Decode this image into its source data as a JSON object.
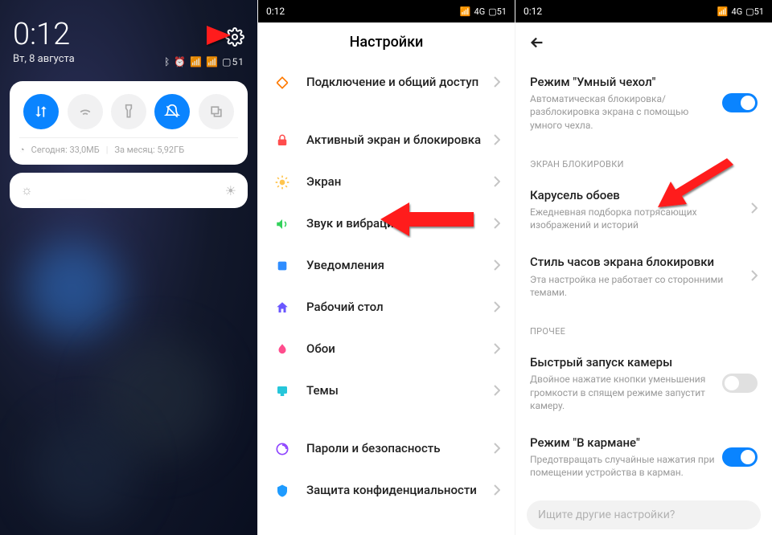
{
  "panel1": {
    "time": "0:12",
    "date": "Вт, 8 августа",
    "battery": "51",
    "data_today_label": "Сегодня:",
    "data_today_val": "33,0МБ",
    "data_month_label": "За месяц:",
    "data_month_val": "5,92ГБ"
  },
  "panel2": {
    "status_time": "0:12",
    "status_net": "4G",
    "status_batt": "51",
    "title": "Настройки",
    "items": [
      {
        "label": "Подключение и общий доступ",
        "icon": "share-icon",
        "color": "#ff7a00"
      },
      {
        "gap": true
      },
      {
        "label": "Активный экран и блокировка",
        "icon": "lock-icon",
        "color": "#ff4d4d"
      },
      {
        "label": "Экран",
        "icon": "sun-icon",
        "color": "#ffc44d"
      },
      {
        "label": "Звук и вибрация",
        "icon": "sound-icon",
        "color": "#32d15b"
      },
      {
        "label": "Уведомления",
        "icon": "notif-icon",
        "color": "#2f8dff"
      },
      {
        "label": "Рабочий стол",
        "icon": "home-icon",
        "color": "#6a57ff"
      },
      {
        "label": "Обои",
        "icon": "wallpaper-icon",
        "color": "#ff4d8d"
      },
      {
        "label": "Темы",
        "icon": "themes-icon",
        "color": "#26c6da"
      },
      {
        "gap": true
      },
      {
        "label": "Пароли и безопасность",
        "icon": "security-icon",
        "color": "#8e44ff"
      },
      {
        "label": "Защита конфиденциальности",
        "icon": "privacy-icon",
        "color": "#1e9bff"
      }
    ]
  },
  "panel3": {
    "status_time": "0:12",
    "status_net": "4G",
    "status_batt": "51",
    "items": [
      {
        "title": "Режим \"Умный чехол\"",
        "desc": "Автоматическая блокировка/разблокировка экрана с помощью умного чехла.",
        "ctrl": "switch-on"
      },
      {
        "section": "ЭКРАН БЛОКИРОВКИ"
      },
      {
        "title": "Карусель обоев",
        "desc": "Ежедневная подборка потрясающих изображений и историй",
        "ctrl": "chevron"
      },
      {
        "title": "Стиль часов экрана блокировки",
        "desc": "Эта настройка не работает со сторонними темами.",
        "ctrl": "chevron"
      },
      {
        "section": "ПРОЧЕЕ"
      },
      {
        "title": "Быстрый запуск камеры",
        "desc": "Двойное нажатие кнопки уменьшения громкости в спящем режиме запустит камеру.",
        "ctrl": "switch-off"
      },
      {
        "title": "Режим \"В кармане\"",
        "desc": "Предотвращать случайные нажатия при помещении устройства в карман.",
        "ctrl": "switch-on"
      }
    ],
    "search_placeholder": "Ищите другие настройки?"
  }
}
